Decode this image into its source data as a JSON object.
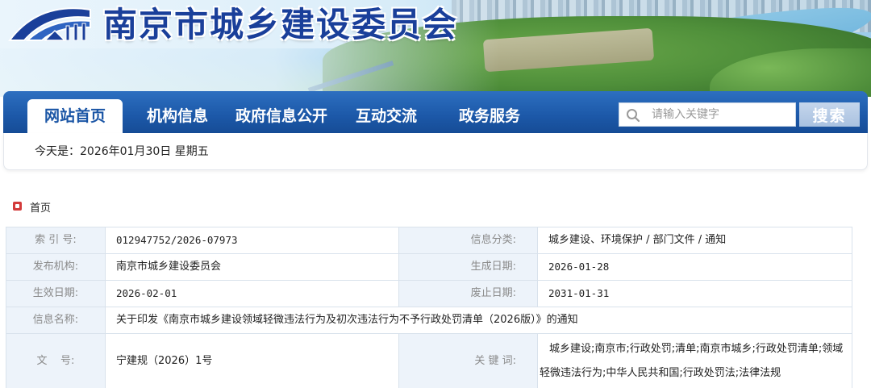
{
  "header": {
    "site_title": "南京市城乡建设委员会"
  },
  "nav": {
    "items": [
      {
        "label": "网站首页",
        "active": true
      },
      {
        "label": "机构信息",
        "active": false
      },
      {
        "label": "政府信息公开",
        "active": false
      },
      {
        "label": "互动交流",
        "active": false
      },
      {
        "label": "政务服务",
        "active": false
      }
    ],
    "search_placeholder": "请输入关键字",
    "search_button": "搜索"
  },
  "date_bar": {
    "text": "今天是：2026年01月30日 星期五"
  },
  "breadcrumb": {
    "home": "首页"
  },
  "info_table": {
    "index_label": "索 引 号:",
    "index_value": "012947752/2026-07973",
    "category_label": "信息分类:",
    "category_value": "城乡建设、环境保护 / 部门文件 / 通知",
    "publisher_label": "发布机构:",
    "publisher_value": "南京市城乡建设委员会",
    "created_label": "生成日期:",
    "created_value": "2026-01-28",
    "effective_label": "生效日期:",
    "effective_value": "2026-02-01",
    "expiry_label": "废止日期:",
    "expiry_value": "2031-01-31",
    "name_label": "信息名称:",
    "name_value": "关于印发《南京市城乡建设领域轻微违法行为及初次违法行为不予行政处罚清单（2026版）》的通知",
    "doc_label": "文    号:",
    "doc_value": "宁建规（2026）1号",
    "keywords_label": "关 键 词:",
    "keywords_value": "城乡建设;南京市;行政处罚;清单;南京市城乡;行政处罚清单;领域轻微违法行为;中华人民共和国;行政处罚法;法律法规"
  },
  "colors": {
    "brand_blue": "#1c58a8",
    "title_blue": "#1a3f9a",
    "label_bg": "#edf3fa",
    "home_icon_red": "#d33b3b"
  }
}
